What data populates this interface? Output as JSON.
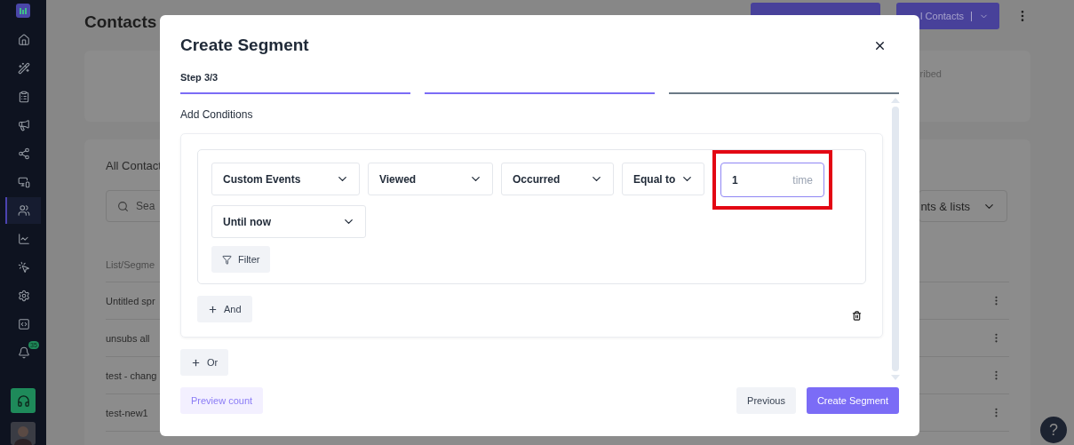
{
  "sidebar": {
    "items": [
      {
        "selected": false
      },
      {
        "selected": false
      },
      {
        "selected": false
      },
      {
        "selected": false
      },
      {
        "selected": false
      },
      {
        "selected": false
      },
      {
        "selected": true
      },
      {
        "selected": false
      },
      {
        "selected": false
      },
      {
        "selected": false
      },
      {
        "selected": false
      },
      {
        "selected": false
      }
    ],
    "notification_badge": "35"
  },
  "page": {
    "title": "Contacts",
    "header_button": "l Contacts",
    "summary_text": "ribed",
    "all_contacts": {
      "title": "All Contact",
      "search_placeholder": "Sea",
      "filter_dropdown": "nts & lists",
      "column_1": "List/Segme",
      "rows": [
        "Untitled spr",
        "unsubs all",
        "test - chang",
        "test-new1"
      ]
    },
    "help_button": "?"
  },
  "modal": {
    "title": "Create Segment",
    "step": "Step 3/3",
    "steps": [
      {
        "completed": true
      },
      {
        "completed": true
      },
      {
        "completed": false
      }
    ],
    "section_title": "Add Conditions",
    "conditions": [
      {
        "kind": "select",
        "value": "Custom Events"
      },
      {
        "kind": "select",
        "value": "Viewed"
      },
      {
        "kind": "select",
        "value": "Occurred"
      },
      {
        "kind": "select",
        "value": "Equal to"
      },
      {
        "kind": "number",
        "value": "1",
        "unit": "time",
        "highlighted": true
      },
      {
        "kind": "select",
        "value": "Until now"
      }
    ],
    "filter_button": "Filter",
    "and_button": "And",
    "or_button": "Or",
    "preview_button": "Preview count",
    "previous_button": "Previous",
    "create_button": "Create Segment"
  }
}
